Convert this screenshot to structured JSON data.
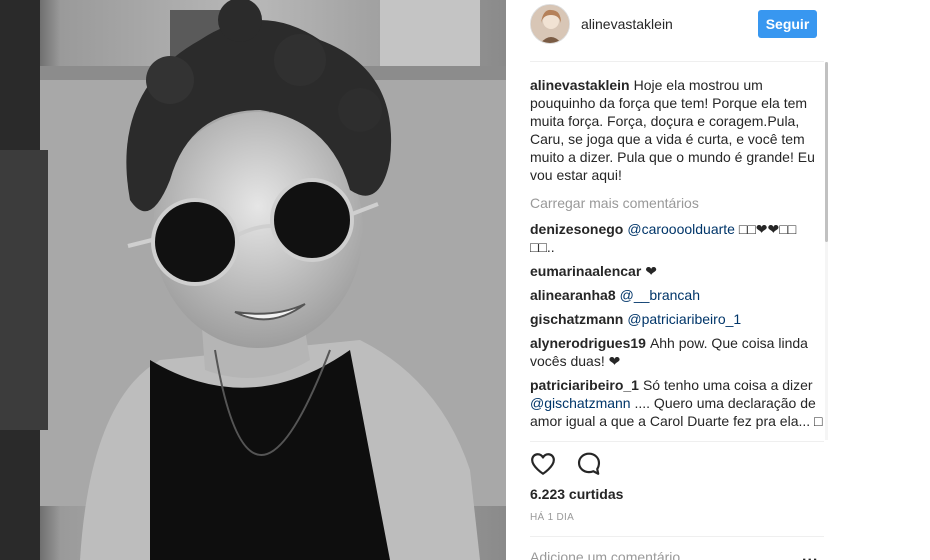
{
  "post": {
    "header": {
      "username": "alinevastaklein",
      "follow_label": "Seguir",
      "avatar_icon": "profile-avatar"
    },
    "caption": {
      "username": "alinevastaklein",
      "text": "Hoje ela mostrou um pouquinho da força que tem! Porque ela tem muita força. Força, doçura e coragem.Pula, Caru, se joga que a vida é curta, e você tem muito a dizer. Pula que o mundo é grande! Eu vou estar aqui!"
    },
    "load_more_label": "Carregar mais comentários",
    "comments": [
      {
        "username": "denizesonego",
        "mention": "@caroooolduarte",
        "text": " □□❤❤□□ □□.."
      },
      {
        "username": "eumarinaalencar",
        "mention": "",
        "text": "❤"
      },
      {
        "username": "alinearanha8",
        "mention": "@__brancah",
        "text": ""
      },
      {
        "username": "gischatzmann",
        "mention": "@patriciaribeiro_1",
        "text": ""
      },
      {
        "username": "alynerodrigues19",
        "mention": "",
        "text": "Ahh pow. Que coisa linda vocês duas! ❤"
      },
      {
        "username": "patriciaribeiro_1",
        "text_before": "Só tenho uma coisa a dizer ",
        "mention": "@gischatzmann",
        "text": " .... Quero uma declaração de amor igual a que a Carol Duarte fez pra ela... □"
      }
    ],
    "likes": "6.223 curtidas",
    "time": "HÁ 1 DIA",
    "comment_placeholder": "Adicione um comentário...",
    "more_options": "...",
    "icons": {
      "like": "heart-icon",
      "comment": "comment-bubble-icon"
    },
    "colors": {
      "accent": "#3897f0",
      "link": "#003569",
      "muted": "#999999"
    }
  }
}
